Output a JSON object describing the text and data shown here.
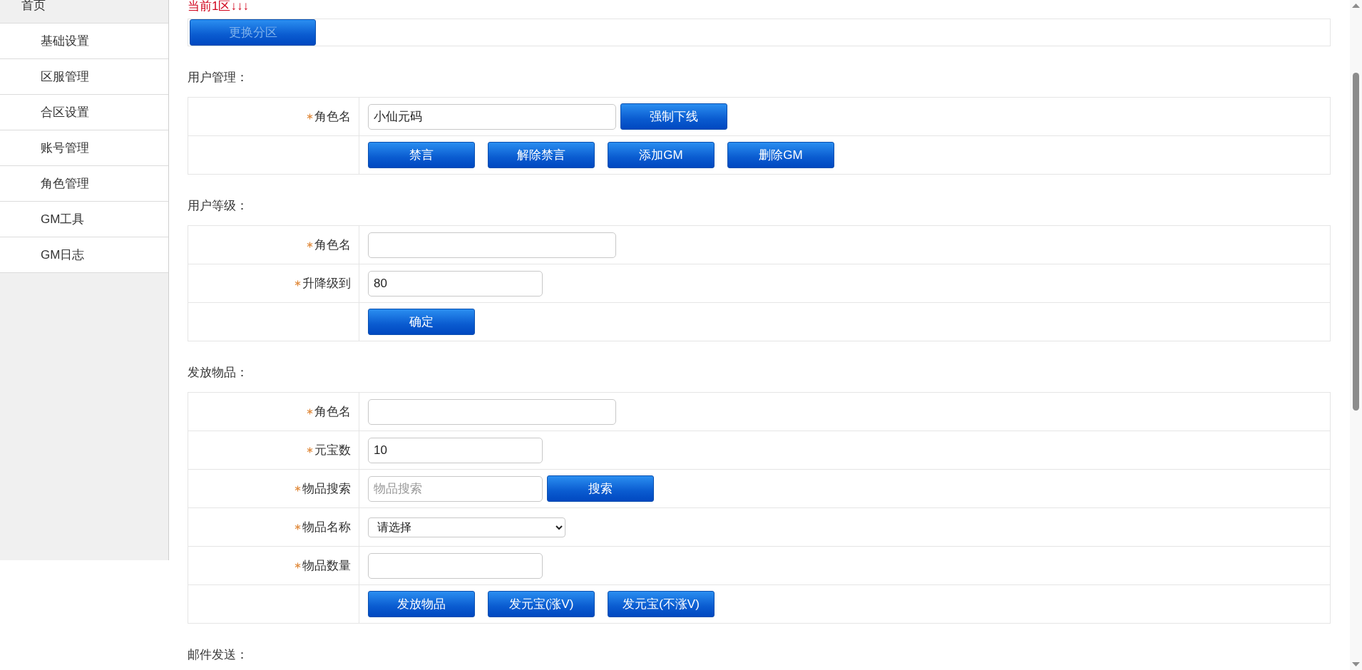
{
  "sidebar": {
    "items": [
      {
        "label": "首页",
        "children": [
          {
            "label": "基础设置"
          },
          {
            "label": "区服管理"
          },
          {
            "label": "合区设置"
          },
          {
            "label": "账号管理"
          },
          {
            "label": "角色管理"
          },
          {
            "label": "GM工具"
          },
          {
            "label": "GM日志"
          }
        ]
      }
    ]
  },
  "notice": "当前1区↓↓↓",
  "zone_button": {
    "label": "更换分区",
    "disabled": true
  },
  "sections": [
    {
      "title": "用户管理：",
      "rows": [
        {
          "kind": "wide_field",
          "label": "角色名",
          "required": true,
          "value": "小仙元码",
          "button": "强制下线"
        },
        {
          "kind": "buttons",
          "buttons": [
            "禁言",
            "解除禁言",
            "添加GM",
            "删除GM"
          ]
        }
      ]
    },
    {
      "title": "用户等级：",
      "rows": [
        {
          "kind": "wide_field",
          "label": "角色名",
          "required": true
        },
        {
          "kind": "field",
          "label": "升降级到",
          "required": true,
          "value": "80"
        },
        {
          "kind": "buttons",
          "buttons": [
            "确定"
          ]
        }
      ]
    },
    {
      "title": "发放物品：",
      "rows": [
        {
          "kind": "wide_field",
          "label": "角色名",
          "required": true
        },
        {
          "kind": "field",
          "label": "元宝数",
          "required": true,
          "value": "10"
        },
        {
          "kind": "field",
          "label": "物品搜索",
          "required": true,
          "placeholder": "物品搜索",
          "button": "搜索"
        },
        {
          "kind": "select",
          "label": "物品名称",
          "required": true,
          "value": "请选择"
        },
        {
          "kind": "field",
          "label": "物品数量",
          "required": true
        },
        {
          "kind": "buttons",
          "buttons": [
            "发放物品",
            "发元宝(涨V)",
            "发元宝(不涨V)"
          ]
        }
      ]
    },
    {
      "title": "邮件发送："
    }
  ]
}
